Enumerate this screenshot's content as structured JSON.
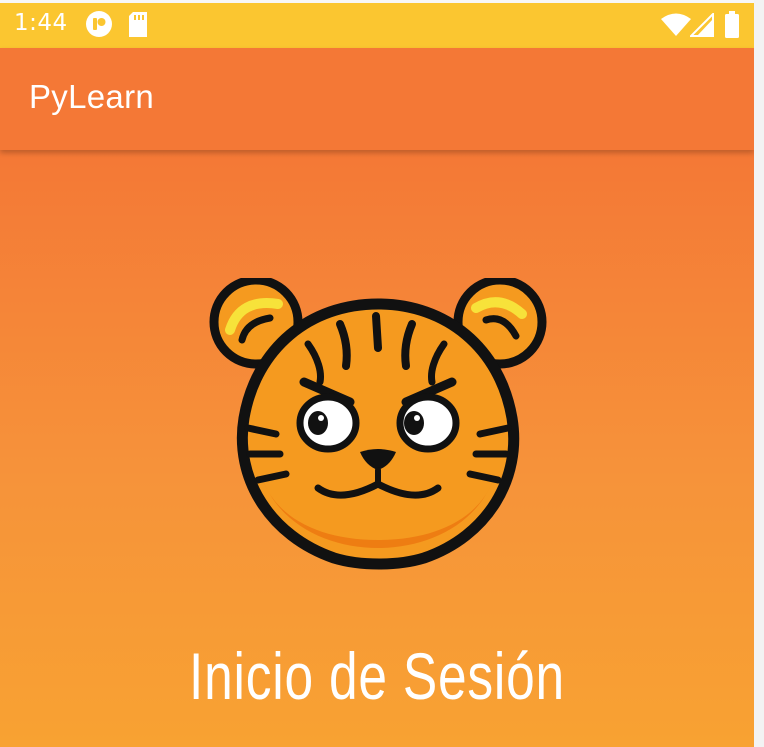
{
  "status_bar": {
    "time": "1:44",
    "icons": [
      "notification-app-icon",
      "sd-card-icon",
      "wifi-icon",
      "cell-signal-icon",
      "battery-icon"
    ]
  },
  "app_bar": {
    "title": "PyLearn"
  },
  "main": {
    "mascot": "tiger-mascot-logo",
    "heading": "Inicio de Sesión"
  },
  "colors": {
    "status_bar": "#FBC630",
    "app_bar": "#F47836",
    "gradient_top": "#F47836",
    "gradient_bottom": "#F8A232",
    "text": "#FFFFFF"
  }
}
